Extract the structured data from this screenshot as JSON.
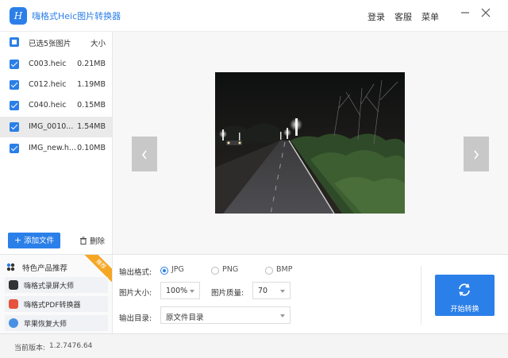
{
  "app": {
    "title": "嗨格式Heic图片转换器",
    "logo_text": "H",
    "accent_color": "#2b7fe8"
  },
  "top_menu": {
    "login": "登录",
    "support": "客服",
    "menu": "菜单",
    "minimize_icon": "minimize-icon",
    "close_icon": "close-icon"
  },
  "file_list": {
    "header_label": "已选5张图片",
    "header_size": "大小",
    "files": [
      {
        "name": "C003.heic",
        "size": "0.21MB",
        "checked": true,
        "selected": false
      },
      {
        "name": "C012.heic",
        "size": "1.19MB",
        "checked": true,
        "selected": false
      },
      {
        "name": "C040.heic",
        "size": "0.15MB",
        "checked": true,
        "selected": false
      },
      {
        "name": "IMG_0010...",
        "size": "1.54MB",
        "checked": true,
        "selected": true
      },
      {
        "name": "IMG_new.h...",
        "size": "0.10MB",
        "checked": true,
        "selected": false
      }
    ],
    "add_button": "添加文件",
    "delete_button": "删除"
  },
  "products": {
    "header": "特色产品推荐",
    "ribbon": "推荐",
    "items": [
      {
        "label": "嗨格式录屏大师",
        "icon": "screen-recorder-icon",
        "color": "#333333"
      },
      {
        "label": "嗨格式PDF转换器",
        "icon": "pdf-icon",
        "color": "#e5533d"
      },
      {
        "label": "苹果恢复大师",
        "icon": "recovery-icon",
        "color": "#4a90e2"
      }
    ]
  },
  "settings": {
    "format_label": "输出格式:",
    "formats": [
      {
        "label": "JPG",
        "selected": true
      },
      {
        "label": "PNG",
        "selected": false
      },
      {
        "label": "BMP",
        "selected": false
      }
    ],
    "size_label": "图片大小:",
    "size_value": "100%",
    "quality_label": "图片质量:",
    "quality_value": "70",
    "dir_label": "输出目录:",
    "dir_value": "原文件目录",
    "start_button": "开始转换"
  },
  "status": {
    "version_label": "当前版本:",
    "version_value": "1.2.7476.64"
  }
}
